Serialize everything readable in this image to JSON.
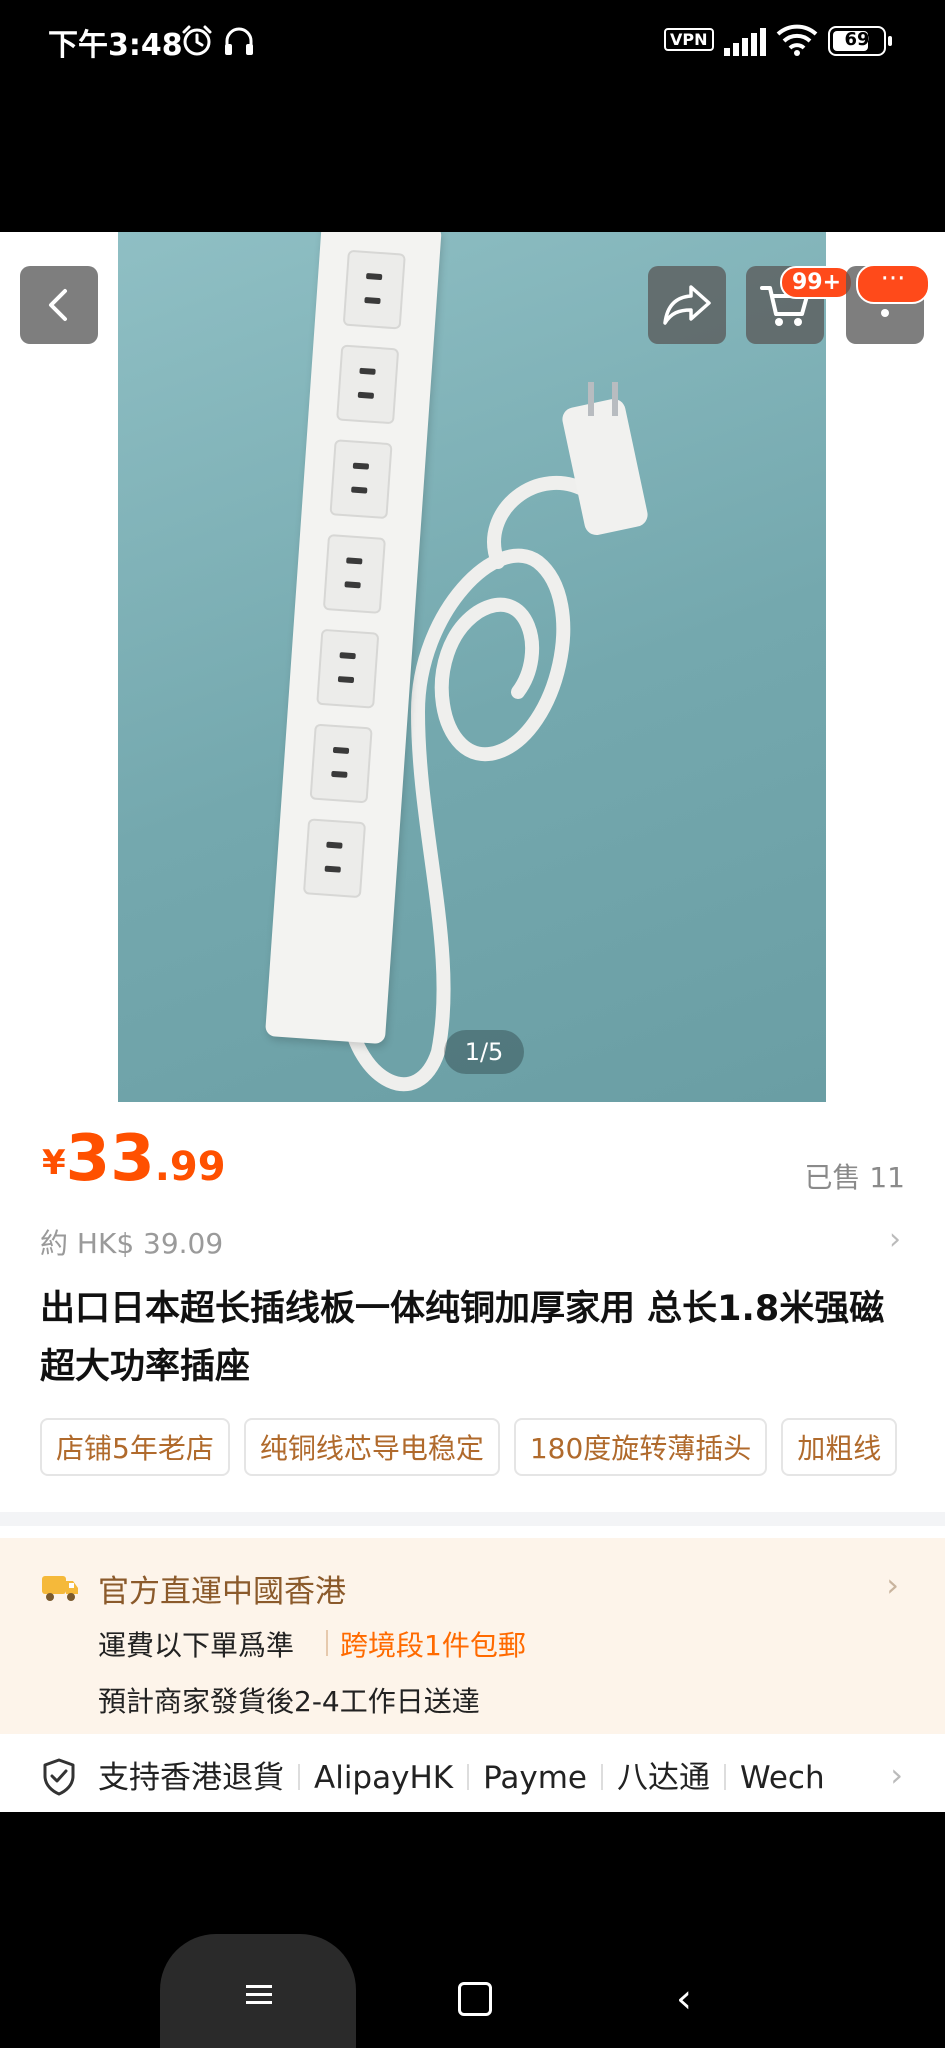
{
  "status_bar": {
    "time": "下午3:48",
    "vpn": "VPN",
    "battery": "69",
    "icons": [
      "alarm-icon",
      "headset-icon",
      "signal-icon",
      "wifi-icon",
      "battery-icon"
    ]
  },
  "header": {
    "cart_badge": "99+",
    "more_badge": "···",
    "icons": [
      "back-icon",
      "share-icon",
      "cart-icon",
      "more-icon"
    ]
  },
  "gallery": {
    "counter": "1/5",
    "colors": {
      "background": "#7fb1b6",
      "strip": "#f3f3f1"
    }
  },
  "product": {
    "price_symbol": "¥",
    "price_int": "33",
    "price_dec": ".99",
    "sold": "已售 11",
    "hkd": "約 HK$ 39.09",
    "title": "出口日本超长插线板一体纯铜加厚家用 总长1.8米强磁超大功率插座",
    "tags": [
      "店铺5年老店",
      "纯铜线芯导电稳定",
      "180度旋转薄插头",
      "加粗线"
    ]
  },
  "shipping": {
    "title": "官方直運中國香港",
    "line1": "運費以下單爲準",
    "free": "跨境段1件包郵",
    "line2": "預計商家發貨後2-4工作日送達"
  },
  "payment": {
    "items": [
      "支持香港退貨",
      "AlipayHK",
      "Payme",
      "八达通",
      "Wech"
    ]
  },
  "colors": {
    "accent": "#ff5000",
    "badge": "#ff4a1a",
    "ship_bg": "#fdf4ea",
    "ship_title": "#8b5a2b"
  }
}
